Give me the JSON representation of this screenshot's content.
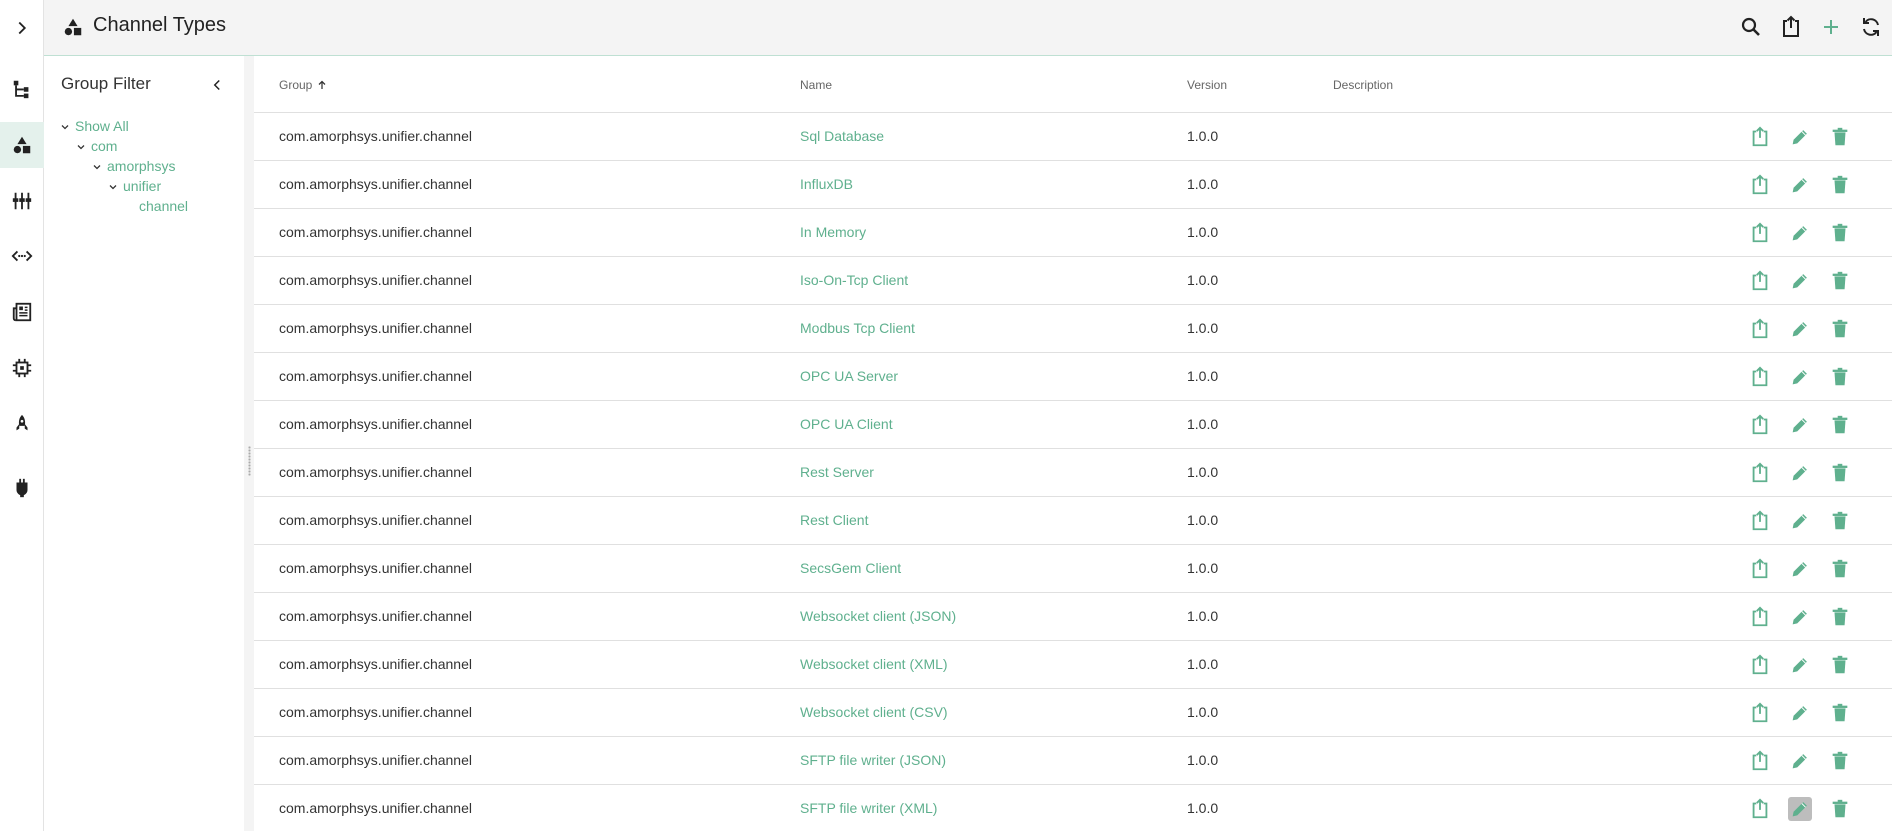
{
  "header": {
    "title": "Channel Types",
    "tools": [
      "search-icon",
      "export-icon",
      "add-icon",
      "refresh-icon"
    ]
  },
  "rail": {
    "items": [
      "chevron-right-icon",
      "tree-icon",
      "shapes-icon",
      "sliders-icon",
      "code-icon",
      "newspaper-icon",
      "chip-icon",
      "rocket-icon",
      "plug-icon"
    ],
    "active_index": 2
  },
  "filter": {
    "title": "Group Filter",
    "tree": [
      {
        "label": "Show All",
        "expanded": true
      },
      {
        "label": "com",
        "expanded": true
      },
      {
        "label": "amorphsys",
        "expanded": true
      },
      {
        "label": "unifier",
        "expanded": true
      },
      {
        "label": "channel",
        "expanded": false
      }
    ]
  },
  "table": {
    "columns": {
      "group": "Group",
      "name": "Name",
      "version": "Version",
      "description": "Description"
    },
    "sort": {
      "column": "group",
      "direction": "ascending"
    },
    "rows": [
      {
        "group": "com.amorphsys.unifier.channel",
        "name": "Sql Database",
        "version": "1.0.0",
        "description": ""
      },
      {
        "group": "com.amorphsys.unifier.channel",
        "name": "InfluxDB",
        "version": "1.0.0",
        "description": ""
      },
      {
        "group": "com.amorphsys.unifier.channel",
        "name": "In Memory",
        "version": "1.0.0",
        "description": ""
      },
      {
        "group": "com.amorphsys.unifier.channel",
        "name": "Iso-On-Tcp Client",
        "version": "1.0.0",
        "description": ""
      },
      {
        "group": "com.amorphsys.unifier.channel",
        "name": "Modbus Tcp Client",
        "version": "1.0.0",
        "description": ""
      },
      {
        "group": "com.amorphsys.unifier.channel",
        "name": "OPC UA Server",
        "version": "1.0.0",
        "description": ""
      },
      {
        "group": "com.amorphsys.unifier.channel",
        "name": "OPC UA Client",
        "version": "1.0.0",
        "description": ""
      },
      {
        "group": "com.amorphsys.unifier.channel",
        "name": "Rest Server",
        "version": "1.0.0",
        "description": ""
      },
      {
        "group": "com.amorphsys.unifier.channel",
        "name": "Rest Client",
        "version": "1.0.0",
        "description": ""
      },
      {
        "group": "com.amorphsys.unifier.channel",
        "name": "SecsGem Client",
        "version": "1.0.0",
        "description": ""
      },
      {
        "group": "com.amorphsys.unifier.channel",
        "name": "Websocket client (JSON)",
        "version": "1.0.0",
        "description": ""
      },
      {
        "group": "com.amorphsys.unifier.channel",
        "name": "Websocket client (XML)",
        "version": "1.0.0",
        "description": ""
      },
      {
        "group": "com.amorphsys.unifier.channel",
        "name": "Websocket client (CSV)",
        "version": "1.0.0",
        "description": ""
      },
      {
        "group": "com.amorphsys.unifier.channel",
        "name": "SFTP file writer (JSON)",
        "version": "1.0.0",
        "description": ""
      },
      {
        "group": "com.amorphsys.unifier.channel",
        "name": "SFTP file writer (XML)",
        "version": "1.0.0",
        "description": ""
      }
    ],
    "row_actions": [
      "export-icon",
      "edit-icon",
      "delete-icon"
    ]
  },
  "colors": {
    "accent": "#5fb08e",
    "active_rail": "#e4f1ec",
    "header_bg": "#f4f4f4"
  }
}
